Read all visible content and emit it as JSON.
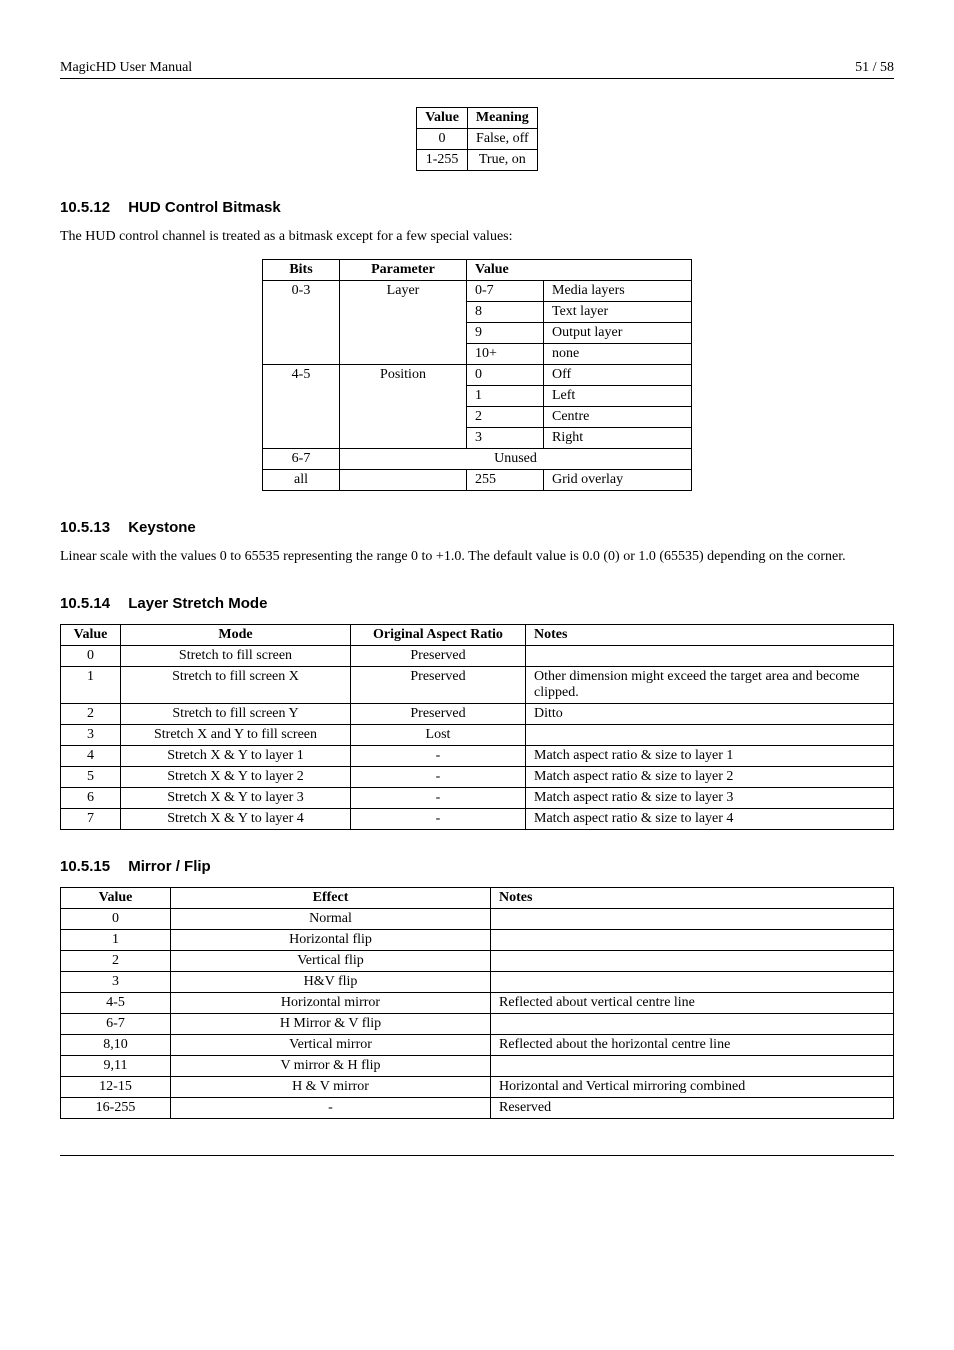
{
  "header": {
    "left": "MagicHD User Manual",
    "right": "51 / 58"
  },
  "table_value_meaning": {
    "headers": [
      "Value",
      "Meaning"
    ],
    "rows": [
      {
        "value": "0",
        "meaning": "False, off"
      },
      {
        "value": "1-255",
        "meaning": "True, on"
      }
    ]
  },
  "sec_hud": {
    "num": "10.5.12",
    "title": "HUD Control Bitmask",
    "intro": "The HUD control channel is treated as a bitmask except for a few special values:",
    "headers": [
      "Bits",
      "Parameter",
      "Value"
    ],
    "layer_rows": [
      {
        "v": "0-7",
        "d": "Media layers"
      },
      {
        "v": "8",
        "d": "Text layer"
      },
      {
        "v": "9",
        "d": "Output layer"
      },
      {
        "v": "10+",
        "d": "none"
      }
    ],
    "bits03": "0-3",
    "param_layer": "Layer",
    "pos_rows": [
      {
        "v": "0",
        "d": "Off"
      },
      {
        "v": "1",
        "d": "Left"
      },
      {
        "v": "2",
        "d": "Centre"
      },
      {
        "v": "3",
        "d": "Right"
      }
    ],
    "bits45": "4-5",
    "param_pos": "Position",
    "bits67": "6-7",
    "unused": "Unused",
    "bits_all": "all",
    "all_v": "255",
    "all_d": "Grid overlay"
  },
  "sec_keystone": {
    "num": "10.5.13",
    "title": "Keystone",
    "body": "Linear scale with the values 0 to 65535 representing the range 0 to +1.0. The default value is 0.0 (0) or 1.0 (65535) depending on the corner."
  },
  "sec_stretch": {
    "num": "10.5.14",
    "title": "Layer Stretch Mode",
    "headers": [
      "Value",
      "Mode",
      "Original Aspect Ratio",
      "Notes"
    ],
    "rows": [
      {
        "value": "0",
        "mode": "Stretch to fill screen",
        "ratio": "Preserved",
        "notes": ""
      },
      {
        "value": "1",
        "mode": "Stretch to fill screen X",
        "ratio": "Preserved",
        "notes": "Other dimension might exceed the target area and become clipped."
      },
      {
        "value": "2",
        "mode": "Stretch to fill screen Y",
        "ratio": "Preserved",
        "notes": "Ditto"
      },
      {
        "value": "3",
        "mode": "Stretch X and Y to fill screen",
        "ratio": "Lost",
        "notes": ""
      },
      {
        "value": "4",
        "mode": "Stretch X & Y to layer 1",
        "ratio": "-",
        "notes": "Match aspect ratio & size to layer 1"
      },
      {
        "value": "5",
        "mode": "Stretch X & Y to layer 2",
        "ratio": "-",
        "notes": "Match aspect ratio & size to layer 2"
      },
      {
        "value": "6",
        "mode": "Stretch X & Y to layer 3",
        "ratio": "-",
        "notes": "Match aspect ratio & size to layer 3"
      },
      {
        "value": "7",
        "mode": "Stretch X & Y to layer 4",
        "ratio": "-",
        "notes": "Match aspect ratio & size to layer 4"
      }
    ]
  },
  "sec_mirror": {
    "num": "10.5.15",
    "title": "Mirror / Flip",
    "headers": [
      "Value",
      "Effect",
      "Notes"
    ],
    "rows": [
      {
        "value": "0",
        "effect": "Normal",
        "notes": ""
      },
      {
        "value": "1",
        "effect": "Horizontal flip",
        "notes": ""
      },
      {
        "value": "2",
        "effect": "Vertical flip",
        "notes": ""
      },
      {
        "value": "3",
        "effect": "H&V flip",
        "notes": ""
      },
      {
        "value": "4-5",
        "effect": "Horizontal mirror",
        "notes": "Reflected about vertical centre line"
      },
      {
        "value": "6-7",
        "effect": "H Mirror & V flip",
        "notes": ""
      },
      {
        "value": "8,10",
        "effect": "Vertical mirror",
        "notes": "Reflected about the horizontal centre line"
      },
      {
        "value": "9,11",
        "effect": "V mirror & H flip",
        "notes": ""
      },
      {
        "value": "12-15",
        "effect": "H & V mirror",
        "notes": "Horizontal and Vertical mirroring combined"
      },
      {
        "value": "16-255",
        "effect": "-",
        "notes": "Reserved"
      }
    ]
  }
}
